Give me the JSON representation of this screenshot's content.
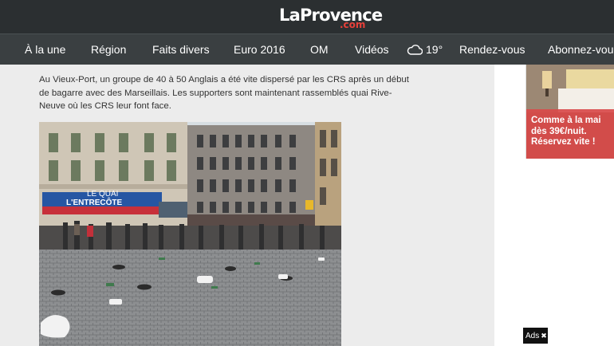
{
  "header": {
    "logo_main": "LaProvence",
    "logo_sub": ".com"
  },
  "nav": {
    "items": [
      "À la une",
      "Région",
      "Faits divers",
      "Euro 2016",
      "OM",
      "Vidéos"
    ],
    "weather_icon": "cloud-icon",
    "weather_temp": "19°",
    "rendezvous": "Rendez-vous",
    "subscribe": "Abonnez-vous"
  },
  "article": {
    "paragraph": "Au Vieux-Port, un groupe de 40 à 50 Anglais a été vite dispersé par les CRS après un début de bagarre avec des Marseillais. Les supporters sont maintenant rassemblés quai Rive-Neuve où les CRS leur font face.",
    "photo": {
      "sign_text": "LE QUAI",
      "sign_text_2": "L'ENTRECÔTE"
    }
  },
  "sidebar": {
    "ad_line1": "Comme à la mai",
    "ad_line2": "dès 39€/nuit.",
    "ad_line3": "Réservez vite !",
    "ads_badge": "Ads",
    "ads_close_icon": "close-icon"
  },
  "colors": {
    "topbar": "#2b2f31",
    "navbar": "#3a3f41",
    "logo_accent": "#e8403a",
    "ad_overlay": "#d94a4a"
  }
}
